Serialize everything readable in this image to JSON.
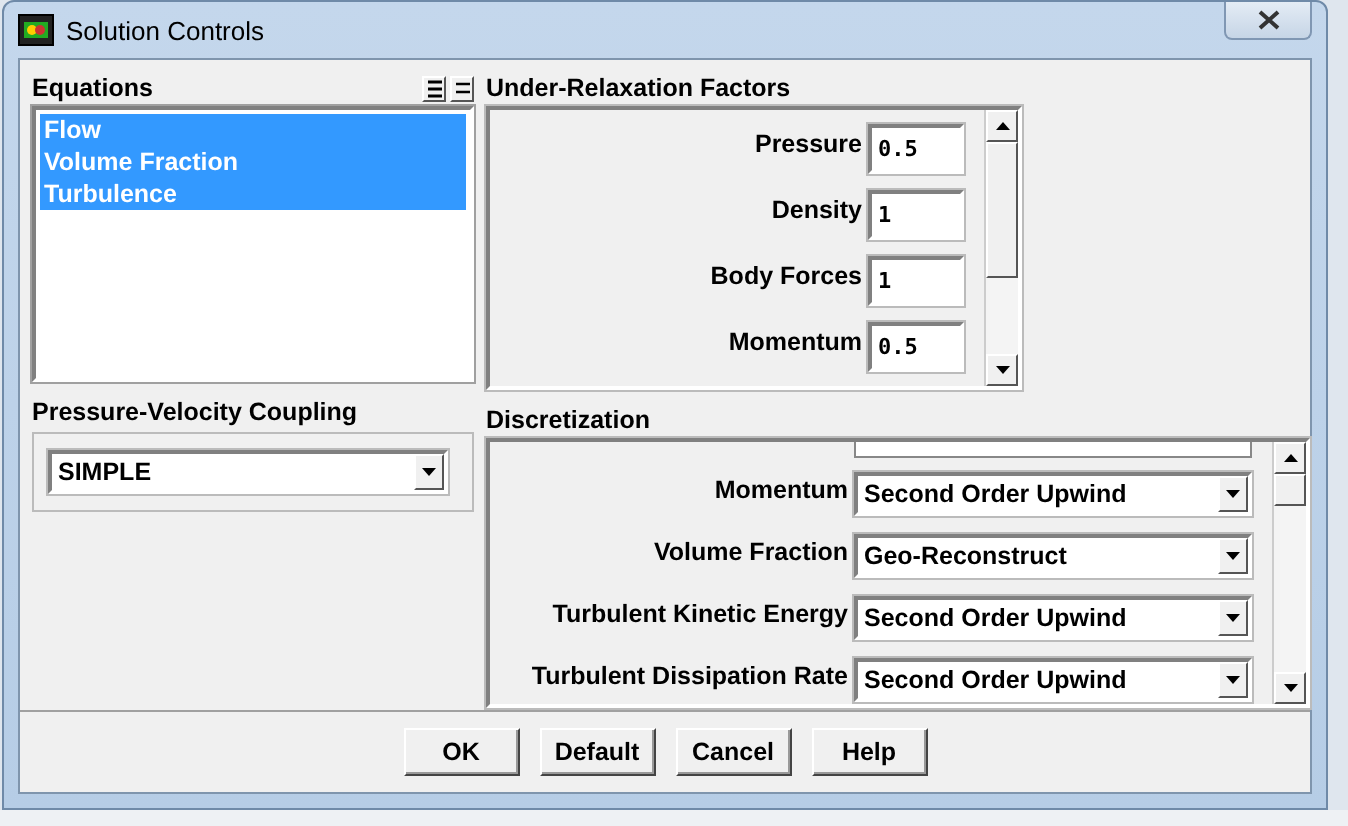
{
  "window": {
    "title": "Solution Controls"
  },
  "equations": {
    "label": "Equations",
    "items": [
      {
        "label": "Flow",
        "selected": true
      },
      {
        "label": "Volume Fraction",
        "selected": true
      },
      {
        "label": "Turbulence",
        "selected": true
      }
    ]
  },
  "pressure_velocity_coupling": {
    "label": "Pressure-Velocity Coupling",
    "value": "SIMPLE"
  },
  "under_relaxation_factors": {
    "label": "Under-Relaxation Factors",
    "fields": [
      {
        "label": "Pressure",
        "value": "0.5"
      },
      {
        "label": "Density",
        "value": "1"
      },
      {
        "label": "Body Forces",
        "value": "1"
      },
      {
        "label": "Momentum",
        "value": "0.5"
      }
    ]
  },
  "discretization": {
    "label": "Discretization",
    "fields": [
      {
        "label": "Momentum",
        "value": "Second Order Upwind"
      },
      {
        "label": "Volume Fraction",
        "value": "Geo-Reconstruct"
      },
      {
        "label": "Turbulent Kinetic Energy",
        "value": "Second Order Upwind"
      },
      {
        "label": "Turbulent Dissipation Rate",
        "value": "Second Order Upwind"
      }
    ]
  },
  "buttons": [
    "OK",
    "Default",
    "Cancel",
    "Help"
  ]
}
